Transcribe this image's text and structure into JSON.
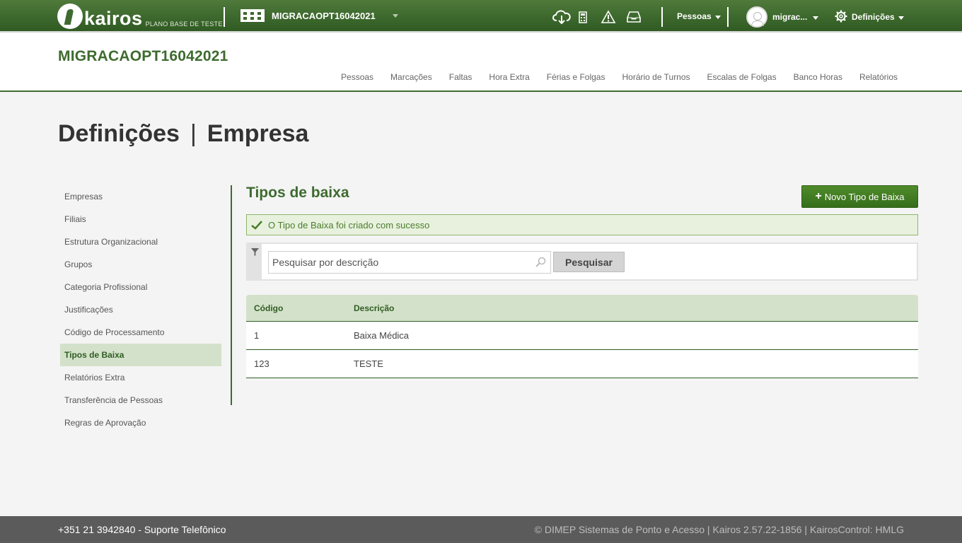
{
  "topbar": {
    "brand": "kairos",
    "brand_subtitle": "PLANO BASE DE TESTE",
    "company": "MIGRACAOPT16042021",
    "people_menu": "Pessoas",
    "user_menu": "migrac...",
    "settings_menu": "Definições",
    "icons": [
      "cloud-download-icon",
      "calculator-icon",
      "warning-icon",
      "inbox-icon",
      "gear-icon"
    ]
  },
  "header": {
    "title": "MIGRACAOPT16042021",
    "nav": [
      "Pessoas",
      "Marcações",
      "Faltas",
      "Hora Extra",
      "Férias e Folgas",
      "Horário de Turnos",
      "Escalas de Folgas",
      "Banco Horas",
      "Relatórios"
    ]
  },
  "page": {
    "heading_left": "Definições",
    "heading_sep": "|",
    "heading_right": "Empresa"
  },
  "sidebar": {
    "items": [
      {
        "label": "Empresas"
      },
      {
        "label": "Filiais"
      },
      {
        "label": "Estrutura Organizacional"
      },
      {
        "label": "Grupos"
      },
      {
        "label": "Categoria Profissional"
      },
      {
        "label": "Justificações"
      },
      {
        "label": "Código de Processamento"
      },
      {
        "label": "Tipos de Baixa",
        "active": true
      },
      {
        "label": "Relatórios Extra"
      },
      {
        "label": "Transferência de Pessoas"
      },
      {
        "label": "Regras de Aprovação"
      }
    ]
  },
  "main": {
    "title": "Tipos de baixa",
    "new_button": "Novo Tipo de Baixa",
    "alert": "O Tipo de Baixa foi criado com sucesso",
    "search_placeholder": "Pesquisar por descrição",
    "search_value": "",
    "search_button": "Pesquisar",
    "table": {
      "columns": [
        "Código",
        "Descrição"
      ],
      "rows": [
        [
          "1",
          "Baixa Médica"
        ],
        [
          "123",
          "TESTE"
        ]
      ]
    }
  },
  "footer": {
    "left": "+351 21 3942840 - Suporte Telefônico",
    "right": "© DIMEP Sistemas de Ponto e Acesso | Kairos 2.57.22-1856 | KairosControl: HMLG"
  },
  "colors": {
    "brand_green": "#3e6b2f",
    "topbar_green": "#3f6a2f",
    "active_bg": "#d3e1ca",
    "button_green": "#3f7c22",
    "alert_bg": "#e8f1de",
    "footer_bg": "#5b5b5b"
  }
}
